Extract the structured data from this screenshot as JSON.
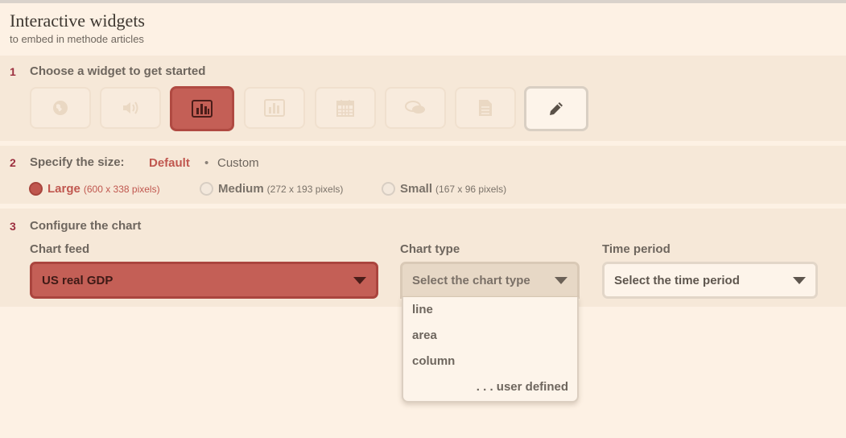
{
  "header": {
    "title": "Interactive widgets",
    "subtitle": "to embed in methode articles"
  },
  "step1": {
    "number": "1",
    "title": "Choose a widget to get started",
    "widgets": [
      {
        "icon": "globe-icon",
        "state": "disabled"
      },
      {
        "icon": "speaker-icon",
        "state": "disabled"
      },
      {
        "icon": "bar-chart-icon",
        "state": "active"
      },
      {
        "icon": "bar-chart-icon",
        "state": "disabled"
      },
      {
        "icon": "calendar-icon",
        "state": "disabled"
      },
      {
        "icon": "speech-bubbles-icon",
        "state": "disabled"
      },
      {
        "icon": "document-icon",
        "state": "disabled"
      },
      {
        "icon": "pencil-icon",
        "state": "enabled"
      }
    ]
  },
  "step2": {
    "number": "2",
    "title": "Specify the size:",
    "size_modes": {
      "default": "Default",
      "separator": "•",
      "custom": "Custom"
    },
    "sizes": [
      {
        "label": "Large",
        "dims": "(600 x 338 pixels)",
        "selected": true
      },
      {
        "label": "Medium",
        "dims": "(272 x 193 pixels)",
        "selected": false
      },
      {
        "label": "Small",
        "dims": "(167 x 96 pixels)",
        "selected": false
      }
    ]
  },
  "step3": {
    "number": "3",
    "title": "Configure the chart",
    "feed": {
      "label": "Chart feed",
      "value": "US real GDP"
    },
    "chart_type": {
      "label": "Chart type",
      "placeholder": "Select the chart type",
      "options": [
        "line",
        "area",
        "column"
      ],
      "user_defined": ". . . user defined"
    },
    "time_period": {
      "label": "Time period",
      "placeholder": "Select the time period"
    }
  },
  "colors": {
    "accent": "#c45f56",
    "step_number": "#9c2f3f",
    "background": "#fdf1e4",
    "panel": "#f6e8d8"
  }
}
